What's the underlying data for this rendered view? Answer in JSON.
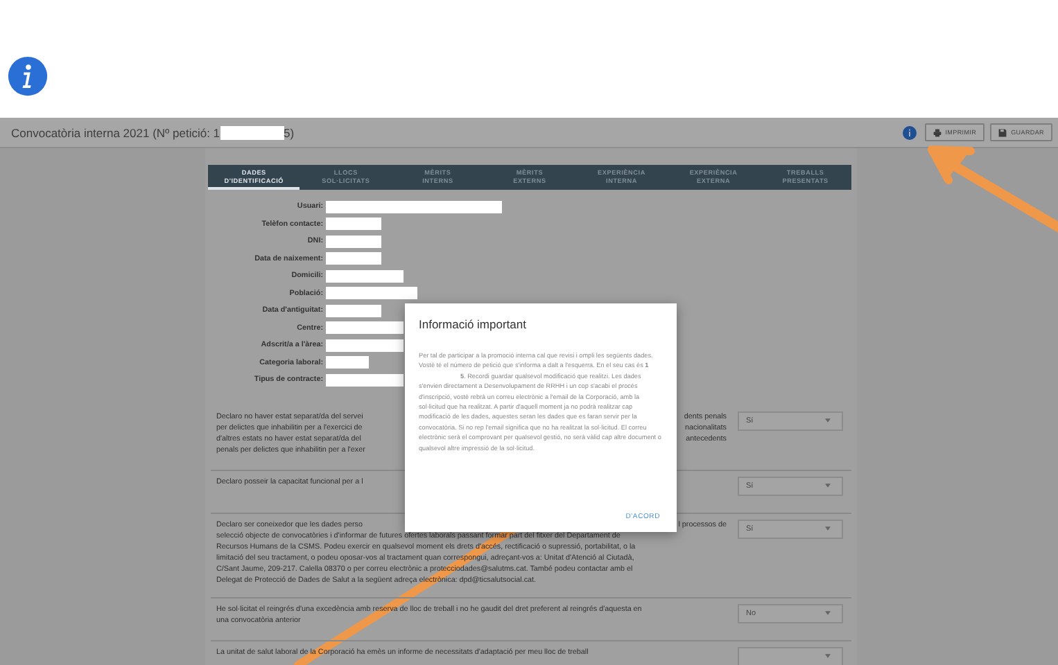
{
  "header": {
    "title_start": "Convocatòria interna 2021 (Nº petició: 1",
    "title_end": "5)",
    "buttons": [
      {
        "label": "IMPRIMIR",
        "kind": "print"
      },
      {
        "label": "GUARDAR",
        "kind": "save"
      }
    ]
  },
  "tabs": [
    {
      "label": "DADES\nD'IDENTIFICACIÓ",
      "selected": true
    },
    {
      "label": "LLOCS\nSOL·LICITATS",
      "selected": false
    },
    {
      "label": "MÈRITS\nINTERNS",
      "selected": false
    },
    {
      "label": "MÈRITS\nEXTERNS",
      "selected": false
    },
    {
      "label": "EXPERIÈNCIA\nINTERNA",
      "selected": false
    },
    {
      "label": "EXPERIÈNCIA\nEXTERNA",
      "selected": false
    },
    {
      "label": "TREBALLS\nPRESENTATS",
      "selected": false
    }
  ],
  "fields": [
    {
      "label": "Usuari:"
    },
    {
      "label": "Telèfon contacte:"
    },
    {
      "label": "DNI:"
    },
    {
      "label": "Data de naixement:"
    },
    {
      "label": "Domicili:"
    },
    {
      "label": "Població:"
    },
    {
      "label": "Data d'antiguitat:"
    },
    {
      "label": "Centre:"
    },
    {
      "label": "Adscrit/a a l'àrea:"
    },
    {
      "label": "Categoria laboral:"
    },
    {
      "label": "Tipus de contracte:"
    }
  ],
  "declarations": [
    {
      "lines": [
        {
          "text": "Declaro no haver estat separat/da del servei",
          "after": "dents penals"
        },
        {
          "text": "per delictes que inhabilitin per a l'exercici de",
          "after": "nacionalitats"
        },
        {
          "text": "d'altres estats no haver estat separat/da del",
          "after": "antecedents"
        },
        {
          "text": "penals per delictes que inhabilitin per a l'exer"
        }
      ],
      "answer": "Sí"
    },
    {
      "lines": [
        {
          "text": "Declaro posseir la capacitat funcional per a l"
        }
      ],
      "answer": "Sí"
    },
    {
      "lines": [
        {
          "text": "Declaro ser coneixedor que les dades perso",
          "after": "l processos de"
        },
        {
          "text": "selecció objecte de convocatòries i d'informar de futures ofertes laborals passant formar part del fitxer del Departament de"
        },
        {
          "text": "Recursos Humans de la CSMS. Podeu exercir en qualsevol moment els drets d'accés, rectificació o supressió, portabilitat, o la"
        },
        {
          "text": "limitació del seu tractament, o podeu oposar-vos al tractament quan correspongui, adreçant-vos a: Unitat d'Atenció al Ciutadà,"
        },
        {
          "text": "C/Sant Jaume, 209-217. Calella 08370 o per correu electrònic a protecciodades@salutms.cat. També podeu contactar amb el"
        },
        {
          "text": "Delegat de Protecció de Dades de Salut a la següent adreça electrònica: dpd@ticsalutsocial.cat."
        }
      ],
      "answer": "Sí"
    },
    {
      "lines": [
        {
          "text": "He sol·licitat el reingrés d'una excedència amb reserva de lloc de treball i no he gaudit del dret preferent al reingrés d'aquesta en"
        },
        {
          "text": "una convocatòria anterior"
        }
      ],
      "answer": "No"
    },
    {
      "lines": [
        {
          "text": "La unitat de salut laboral de la Corporació ha emès un informe de necessitats d'adaptació per meu lloc de treball"
        }
      ]
    }
  ],
  "dialog": {
    "title": "Informació important",
    "body_start": "Per tal de participar a la promoció interna cal que revisi i ompli les següents dades. Vostè té el número de petició que s'informa a dalt a l'esquerra. En el seu cas és **1**",
    "body_end": "**5**. Recordi guardar qualsevol modificació que realitzi. Les dades s'envien directament a Desenvolupament de RRHH i un cop s'acabi el procés d'inscripció, vostè rebrà un correu electrònic a l'email de la Corporació, amb la sol·licitud que ha realitzat. A partir d'aquell moment ja no podrà realitzar cap modificació de les dades, aquestes seran les dades que es faran servir per la convocatòria. Si no rep l'email significa que no ha realitzat la sol·licitud. El correu electrònic serà el comprovant per qualsevol gestió, no serà vàlid cap altre document o qualsevol altre impressió de la sol·licitud.",
    "button": "D'ACORD"
  }
}
